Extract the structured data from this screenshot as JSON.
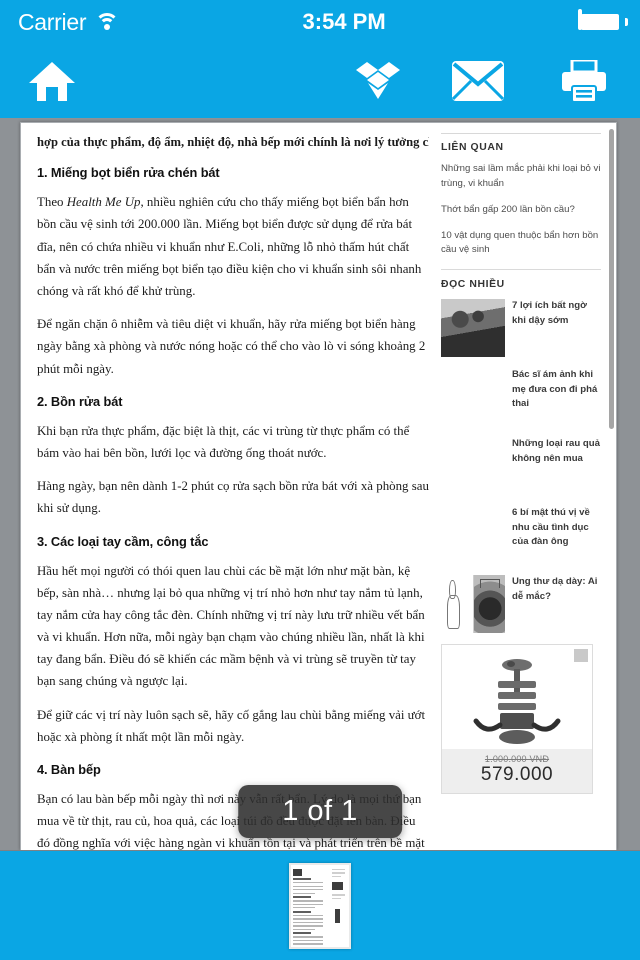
{
  "status_bar": {
    "carrier": "Carrier",
    "wifi_icon": "wifi-icon",
    "time": "3:54 PM",
    "battery_icon": "battery-full-icon"
  },
  "toolbar": {
    "background_color": "#0aa6e4",
    "buttons": [
      {
        "name": "home-button",
        "icon": "home-icon"
      },
      {
        "name": "dropbox-button",
        "icon": "dropbox-icon"
      },
      {
        "name": "mail-button",
        "icon": "envelope-icon"
      },
      {
        "name": "print-button",
        "icon": "printer-icon"
      }
    ]
  },
  "document": {
    "top_partial_line": "hợp của thực phẩm, độ ẩm, nhiệt độ, nhà bếp mới chính là nơi lý tưởng cho vi khuẩn sinh sôi.",
    "sections": [
      {
        "heading": "1. Miếng bọt biển rửa chén bát",
        "paragraphs": [
          "Theo Health Me Up, nhiều nghiên cứu cho thấy miếng bọt biển bẩn hơn bồn cầu vệ sinh tới 200.000 lần. Miếng bọt biển được sử dụng để rửa bát đĩa, nên có chứa nhiều vi khuẩn như E.Coli, những lỗ nhỏ thấm hút chất bẩn và nước trên miếng bọt biển tạo điều kiện cho vi khuẩn sinh sôi nhanh chóng và rất khó để khử trùng.",
          "Để ngăn chặn ô nhiễm và tiêu diệt vi khuẩn, hãy rửa miếng bọt biển hàng ngày bằng xà phòng và nước nóng hoặc có thể cho vào lò vi sóng khoảng 2 phút mỗi ngày."
        ],
        "italic_phrase": "Health Me Up"
      },
      {
        "heading": "2. Bồn rửa bát",
        "paragraphs": [
          "Khi bạn rửa thực phẩm, đặc biệt là thịt, các vi trùng từ thực phẩm có thể bám vào hai bên bồn, lưới lọc và đường ống thoát nước.",
          "Hàng ngày, bạn nên dành 1-2 phút cọ rửa sạch bồn rửa bát với xà phòng sau khi sử dụng."
        ]
      },
      {
        "heading": "3. Các loại tay cầm, công tắc",
        "paragraphs": [
          "Hầu hết mọi người có thói quen lau chùi các bề mặt lớn như mặt bàn, kệ bếp, sàn nhà… nhưng lại bỏ qua những vị trí nhỏ hơn như tay nắm tủ lạnh, tay nắm cửa hay công tắc đèn. Chính những vị trí này lưu trữ nhiều vết bẩn và vi khuẩn. Hơn nữa, mỗi ngày bạn chạm vào chúng nhiều lần, nhất là khi tay đang bẩn. Điều đó sẽ khiến các mầm bệnh và vi trùng sẽ truyền từ tay bạn sang chúng và ngược lại.",
          "Để giữ các vị trí này luôn sạch sẽ, hãy cố gắng lau chùi bằng miếng vải ướt hoặc xà phòng ít nhất một lần mỗi ngày."
        ]
      },
      {
        "heading": "4. Bàn bếp",
        "paragraphs": [
          "Bạn có lau bàn bếp mỗi ngày thì nơi này vẫn rất bẩn. Lý do là mọi thứ bạn mua về từ thịt, rau củ, hoa quả, các loại túi đồ đều được đặt lên bàn. Điều đó đồng nghĩa với việc hàng ngàn vi khuẩn tồn tại và phát triển trên bề mặt của bàn. Để giúp việc lau bàn hiệu quả hơn, bạn nên cắt thêm vài lát củ cái hoặc dưa chuột hòa vào nước để lau. Cũng có thể sử dụng một chất"
        ]
      }
    ],
    "sidebar": {
      "related": {
        "heading": "LIÊN QUAN",
        "links": [
          "Những sai lầm mắc phải khi loại bỏ vi trùng, vi khuẩn",
          "Thớt bẩn gấp 200 lần bồn cầu?",
          "10 vật dụng quen thuộc bẩn hơn bồn cầu vệ sinh"
        ]
      },
      "popular": {
        "heading": "ĐỌC NHIỀU",
        "items": [
          {
            "title": "7 lợi ích bất ngờ khi dậy sớm",
            "has_thumb": true,
            "thumb": "photo-sunrise-field"
          },
          {
            "title": "Bác sĩ ám ảnh khi mẹ đưa con đi phá thai",
            "has_thumb": false,
            "thumb": ""
          },
          {
            "title": "Những loại rau quả không nên mua",
            "has_thumb": false,
            "thumb": ""
          },
          {
            "title": "6 bí mật thú vị về nhu cầu tình dục của đàn ông",
            "has_thumb": false,
            "thumb": ""
          },
          {
            "title": "Ung thư dạ dày: Ai dễ mắc?",
            "has_thumb": true,
            "thumb": "medical-diagram-xray"
          }
        ]
      },
      "ad": {
        "name": "product-advertisement",
        "image_alt": "exercise-machine",
        "old_price": "1.000.000 VNĐ",
        "new_price": "579.000"
      }
    }
  },
  "page_indicator": {
    "label": "1 of 1"
  },
  "thumbnail_strip": {
    "page_thumbnail_name": "page-thumbnail-1"
  }
}
